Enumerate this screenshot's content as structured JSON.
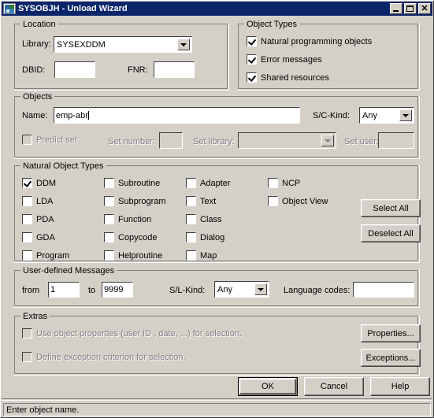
{
  "window": {
    "title": "SYSOBJH - Unload Wizard",
    "icon": "application-icon",
    "buttons": {
      "minimize": "minimize-button",
      "maximize": "maximize-button",
      "close": "close-button"
    }
  },
  "location": {
    "legend": "Location",
    "library_label": "Library:",
    "library_value": "SYSEXDDM",
    "dbid_label": "DBID:",
    "dbid_value": "",
    "fnr_label": "FNR:",
    "fnr_value": ""
  },
  "object_types": {
    "legend": "Object Types",
    "items": [
      {
        "label": "Natural programming objects",
        "checked": true
      },
      {
        "label": "Error messages",
        "checked": true
      },
      {
        "label": "Shared resources",
        "checked": true
      }
    ]
  },
  "objects": {
    "legend": "Objects",
    "name_label": "Name:",
    "name_value": "emp-abr",
    "sc_kind_label": "S/C-Kind:",
    "sc_kind_value": "Any",
    "predict_set_label": "Predict set",
    "predict_set_checked": false,
    "set_number_label": "Set number:",
    "set_number_value": "",
    "set_library_label": "Set library:",
    "set_library_value": "",
    "set_user_label": "Set user:",
    "set_user_value": ""
  },
  "natural_object_types": {
    "legend": "Natural Object Types",
    "column1": [
      {
        "label": "DDM",
        "checked": true
      },
      {
        "label": "LDA",
        "checked": false
      },
      {
        "label": "PDA",
        "checked": false
      },
      {
        "label": "GDA",
        "checked": false
      },
      {
        "label": "Program",
        "checked": false
      }
    ],
    "column2": [
      {
        "label": "Subroutine",
        "checked": false
      },
      {
        "label": "Subprogram",
        "checked": false
      },
      {
        "label": "Function",
        "checked": false
      },
      {
        "label": "Copycode",
        "checked": false
      },
      {
        "label": "Helproutine",
        "checked": false
      }
    ],
    "column3": [
      {
        "label": "Adapter",
        "checked": false
      },
      {
        "label": "Text",
        "checked": false
      },
      {
        "label": "Class",
        "checked": false
      },
      {
        "label": "Dialog",
        "checked": false
      },
      {
        "label": "Map",
        "checked": false
      }
    ],
    "column4": [
      {
        "label": "NCP",
        "checked": false
      },
      {
        "label": "Object View",
        "checked": false
      }
    ],
    "select_all_label": "Select All",
    "deselect_all_label": "Deselect All"
  },
  "user_defined_messages": {
    "legend": "User-defined Messages",
    "from_label": "from",
    "from_value": "1",
    "to_label": "to",
    "to_value": "9999",
    "sl_kind_label": "S/L-Kind:",
    "sl_kind_value": "Any",
    "language_codes_label": "Language codes:",
    "language_codes_value": ""
  },
  "extras": {
    "legend": "Extras",
    "use_object_properties_label": "Use object properties (user ID , date, ...)  for selection.",
    "use_object_properties_checked": false,
    "define_exception_label": "Define exception criterion for selection.",
    "define_exception_checked": false,
    "properties_button": "Properties...",
    "exceptions_button": "Exceptions..."
  },
  "footer": {
    "ok": "OK",
    "cancel": "Cancel",
    "help": "Help"
  },
  "statusbar": {
    "message": "Enter object name."
  },
  "colors": {
    "face": "#d4d0c8",
    "titlebar": "#0a246a",
    "field": "#ffffff",
    "disabled_text": "#808080"
  }
}
